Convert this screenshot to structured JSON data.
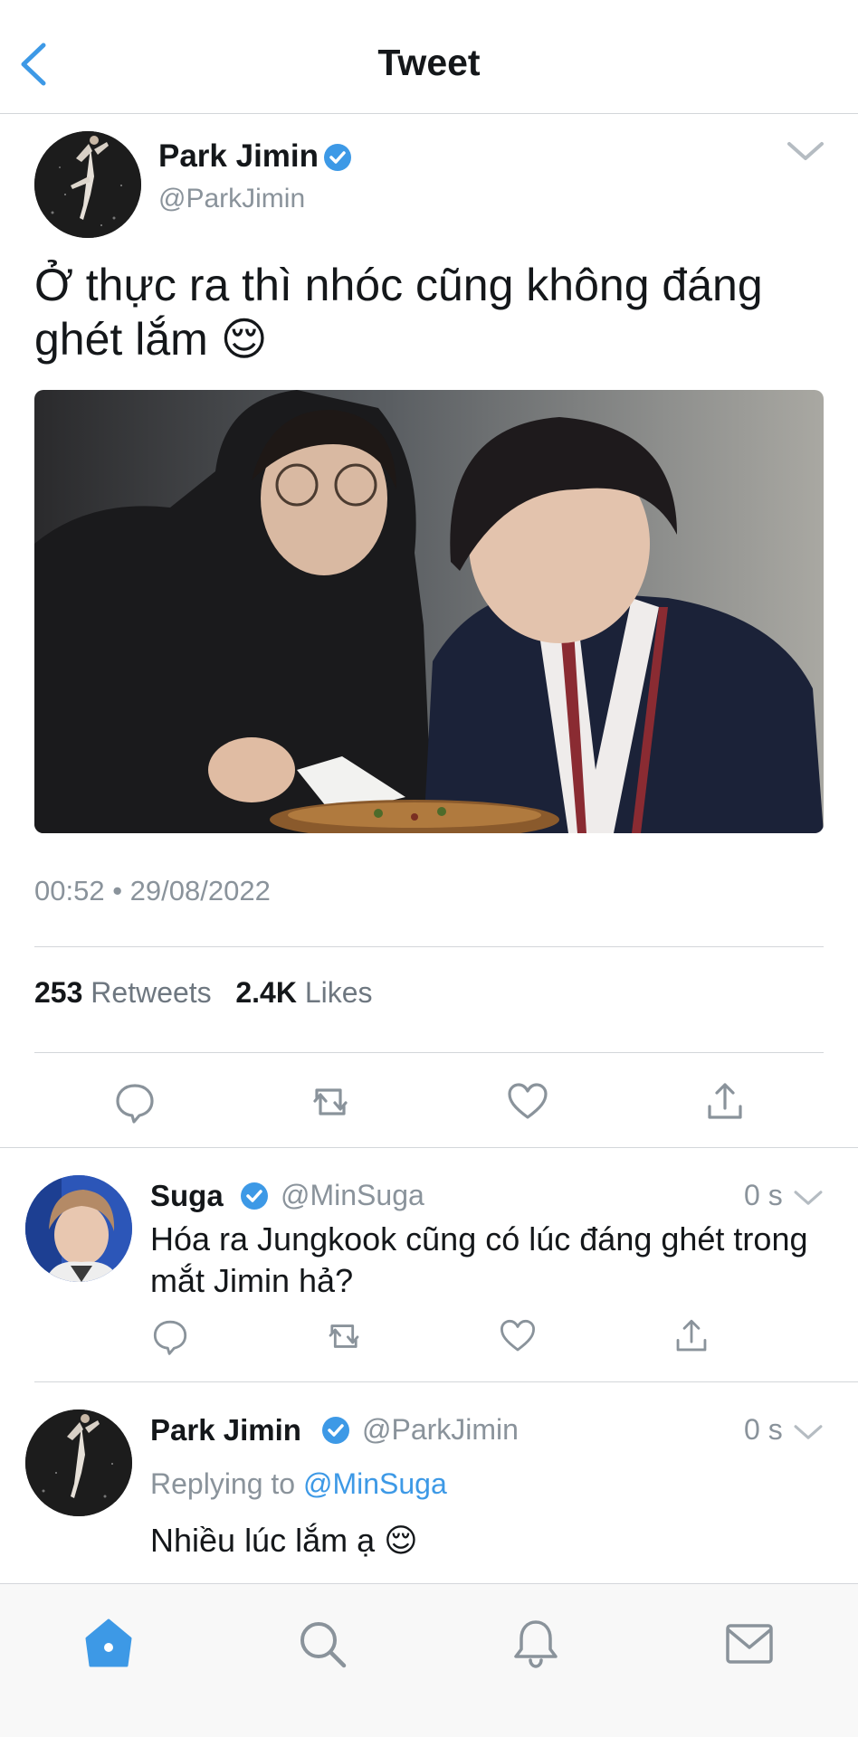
{
  "header": {
    "title": "Tweet"
  },
  "icons": {
    "back": "chevron-left-icon",
    "more": "chevron-down-icon",
    "verified": "verified-badge-icon",
    "reply": "reply-icon",
    "retweet": "retweet-icon",
    "like": "heart-icon",
    "share": "share-icon",
    "home": "home-icon",
    "search": "search-icon",
    "notifications": "bell-icon",
    "messages": "mail-icon"
  },
  "colors": {
    "accent": "#3d99e6",
    "text": "#14171a",
    "muted": "#8a939b",
    "divider": "#d3d6da"
  },
  "tweet": {
    "author_name": "Park Jimin",
    "author_handle": "@ParkJimin",
    "text": "Ở thực ra thì nhóc cũng không đáng ghét lắm 😌",
    "timestamp": "00:52 • 29/08/2022",
    "retweet_count": "253",
    "retweet_label": "Retweets",
    "like_count": "2.4K",
    "like_label": "Likes"
  },
  "replies": [
    {
      "name": "Suga",
      "handle": "@MinSuga",
      "time": "0 s",
      "text": "Hóa ra Jungkook cũng có lúc đáng ghét trong mắt Jimin hả?"
    },
    {
      "name": "Park Jimin",
      "handle": "@ParkJimin",
      "time": "0 s",
      "replying_prefix": "Replying to",
      "replying_to": "@MinSuga",
      "text": "Nhiều lúc lắm ạ 😌"
    }
  ]
}
